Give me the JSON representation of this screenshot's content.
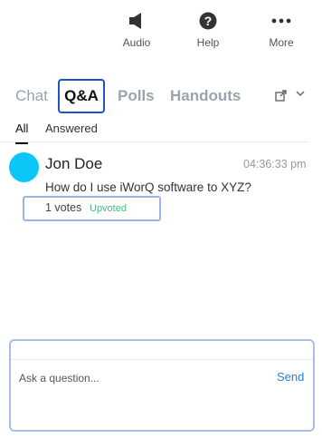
{
  "toolbar": {
    "items": [
      {
        "label": "Audio",
        "icon": "speaker-icon"
      },
      {
        "label": "Help",
        "icon": "help-icon"
      },
      {
        "label": "More",
        "icon": "more-dots-icon"
      }
    ]
  },
  "tabs": {
    "items": [
      "Chat",
      "Q&A",
      "Polls",
      "Handouts"
    ],
    "active": "Q&A"
  },
  "subtabs": {
    "items": [
      "All",
      "Answered"
    ],
    "active": "All"
  },
  "questions": [
    {
      "author": "Jon Doe",
      "time": "04:36:33 pm",
      "text": "How do I use iWorQ software to XYZ?",
      "votes": "1 votes",
      "status": "Upvoted",
      "avatar_color": "#0cc6f7"
    }
  ],
  "ask": {
    "placeholder": "Ask a question...",
    "send_label": "Send"
  },
  "colors": {
    "accent": "#1f52c8",
    "send": "#2a7fd3",
    "upvoted": "#3dbf7d"
  }
}
